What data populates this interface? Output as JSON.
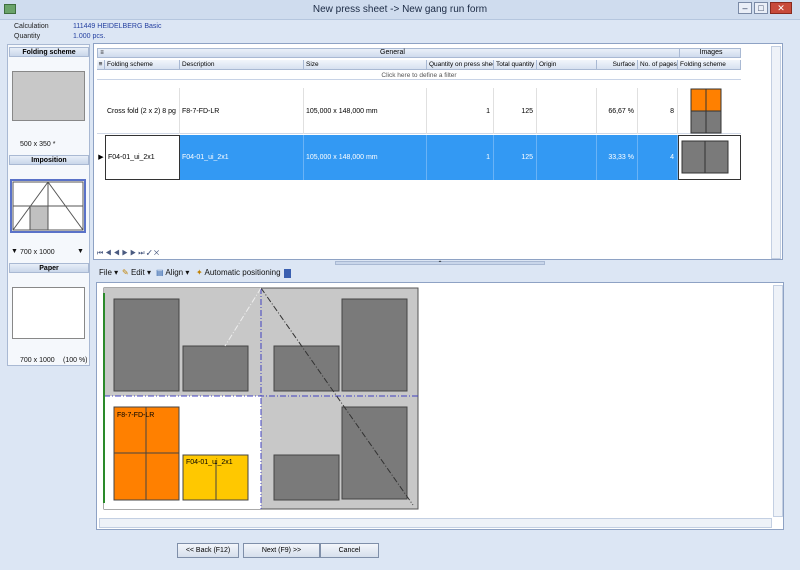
{
  "window": {
    "title": "New press sheet -> New gang run form"
  },
  "header": {
    "calc_label": "Calculation",
    "calc_value": "111449 HEIDELBERG Basic",
    "qty_label": "Quantity",
    "qty_value": "1.000 pcs."
  },
  "left": {
    "folding_title": "Folding scheme",
    "folding_size": "500 x 350 *",
    "imposition_title": "Imposition",
    "imposition_size": "700 x 1000",
    "paper_title": "Paper",
    "paper_size": "700 x 1000",
    "paper_pct": "(100 %)"
  },
  "grid": {
    "group_general": "General",
    "group_images": "Images",
    "columns": [
      "Folding scheme",
      "Description",
      "Size",
      "Quantity on press sheet",
      "Total quantity",
      "Origin",
      "Surface",
      "No. of pages",
      "Folding scheme"
    ],
    "filter_text": "Click here to define a filter",
    "rows": [
      {
        "folding": "Cross fold (2 x 2)  8 pg",
        "description": "F8-7-FD-LR",
        "size": "105,000 x  148,000 mm",
        "qty_sheet": "1",
        "total": "125",
        "origin": "",
        "surface": "66,67 %",
        "pages": "8"
      },
      {
        "folding": "F04-01_ui_2x1",
        "description": "F04-01_ui_2x1",
        "size": "105,000 x  148,000 mm",
        "qty_sheet": "1",
        "total": "125",
        "origin": "",
        "surface": "33,33 %",
        "pages": "4"
      }
    ]
  },
  "toolbar": {
    "file": "File",
    "edit": "Edit",
    "align": "Align",
    "auto": "Automatic positioning"
  },
  "canvas": {
    "label1": "F8-7-FD-LR",
    "label2": "F04-01_ui_2x1"
  },
  "buttons": {
    "back": "<< Back (F12)",
    "next": "Next (F9) >>",
    "cancel": "Cancel"
  },
  "colors": {
    "selection": "#3399f3",
    "orange": "#ff8000",
    "yellow": "#ffc800",
    "gray": "#7a7a7a"
  },
  "icons": [
    "app-icon",
    "minimize-icon",
    "maximize-icon",
    "close-icon",
    "filter-icon",
    "edit-icon",
    "align-icon",
    "auto-position-icon"
  ]
}
